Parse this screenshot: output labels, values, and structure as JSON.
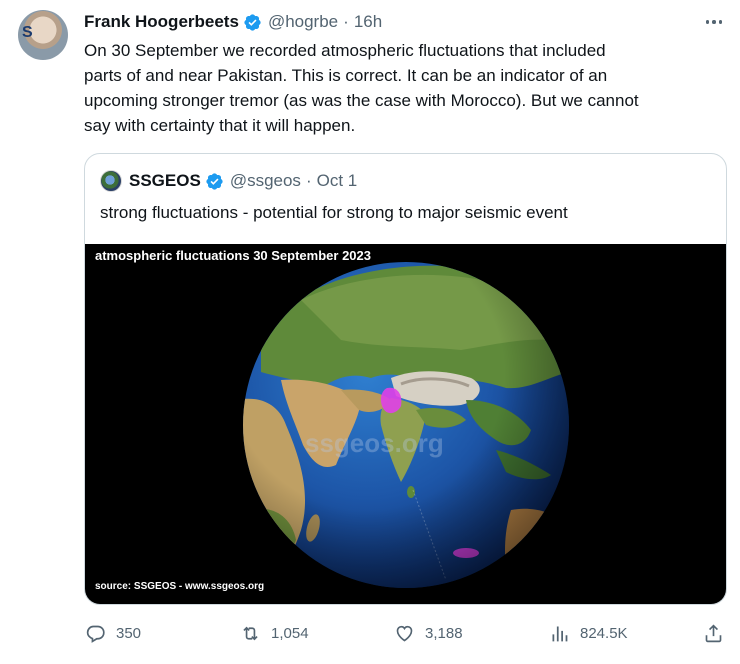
{
  "tweet": {
    "author_name": "Frank Hoogerbeets",
    "handle": "@hogrbe",
    "separator": "·",
    "time": "16h",
    "text": "On 30 September we recorded atmospheric fluctuations that included\nparts of and near Pakistan. This is correct. It can be an indicator of an\nupcoming stronger tremor (as was the case with Morocco). But we cannot\nsay with certainty that it will happen."
  },
  "quoted_tweet": {
    "author_name": "SSGEOS",
    "handle": "@ssgeos",
    "separator": "·",
    "date": "Oct 1",
    "text": "strong fluctuations - potential for strong to major seismic event",
    "media": {
      "title": "atmospheric fluctuations 30 September 2023",
      "watermark": "ssgeos.org",
      "source": "source: SSGEOS - www.ssgeos.org",
      "highlight_color": "#e040e8"
    }
  },
  "actions": {
    "replies": "350",
    "retweets": "1,054",
    "likes": "3,188",
    "views": "824.5K"
  },
  "colors": {
    "verified": "#1d9bf0",
    "secondary_text": "#536471",
    "border": "#cfd9de"
  }
}
